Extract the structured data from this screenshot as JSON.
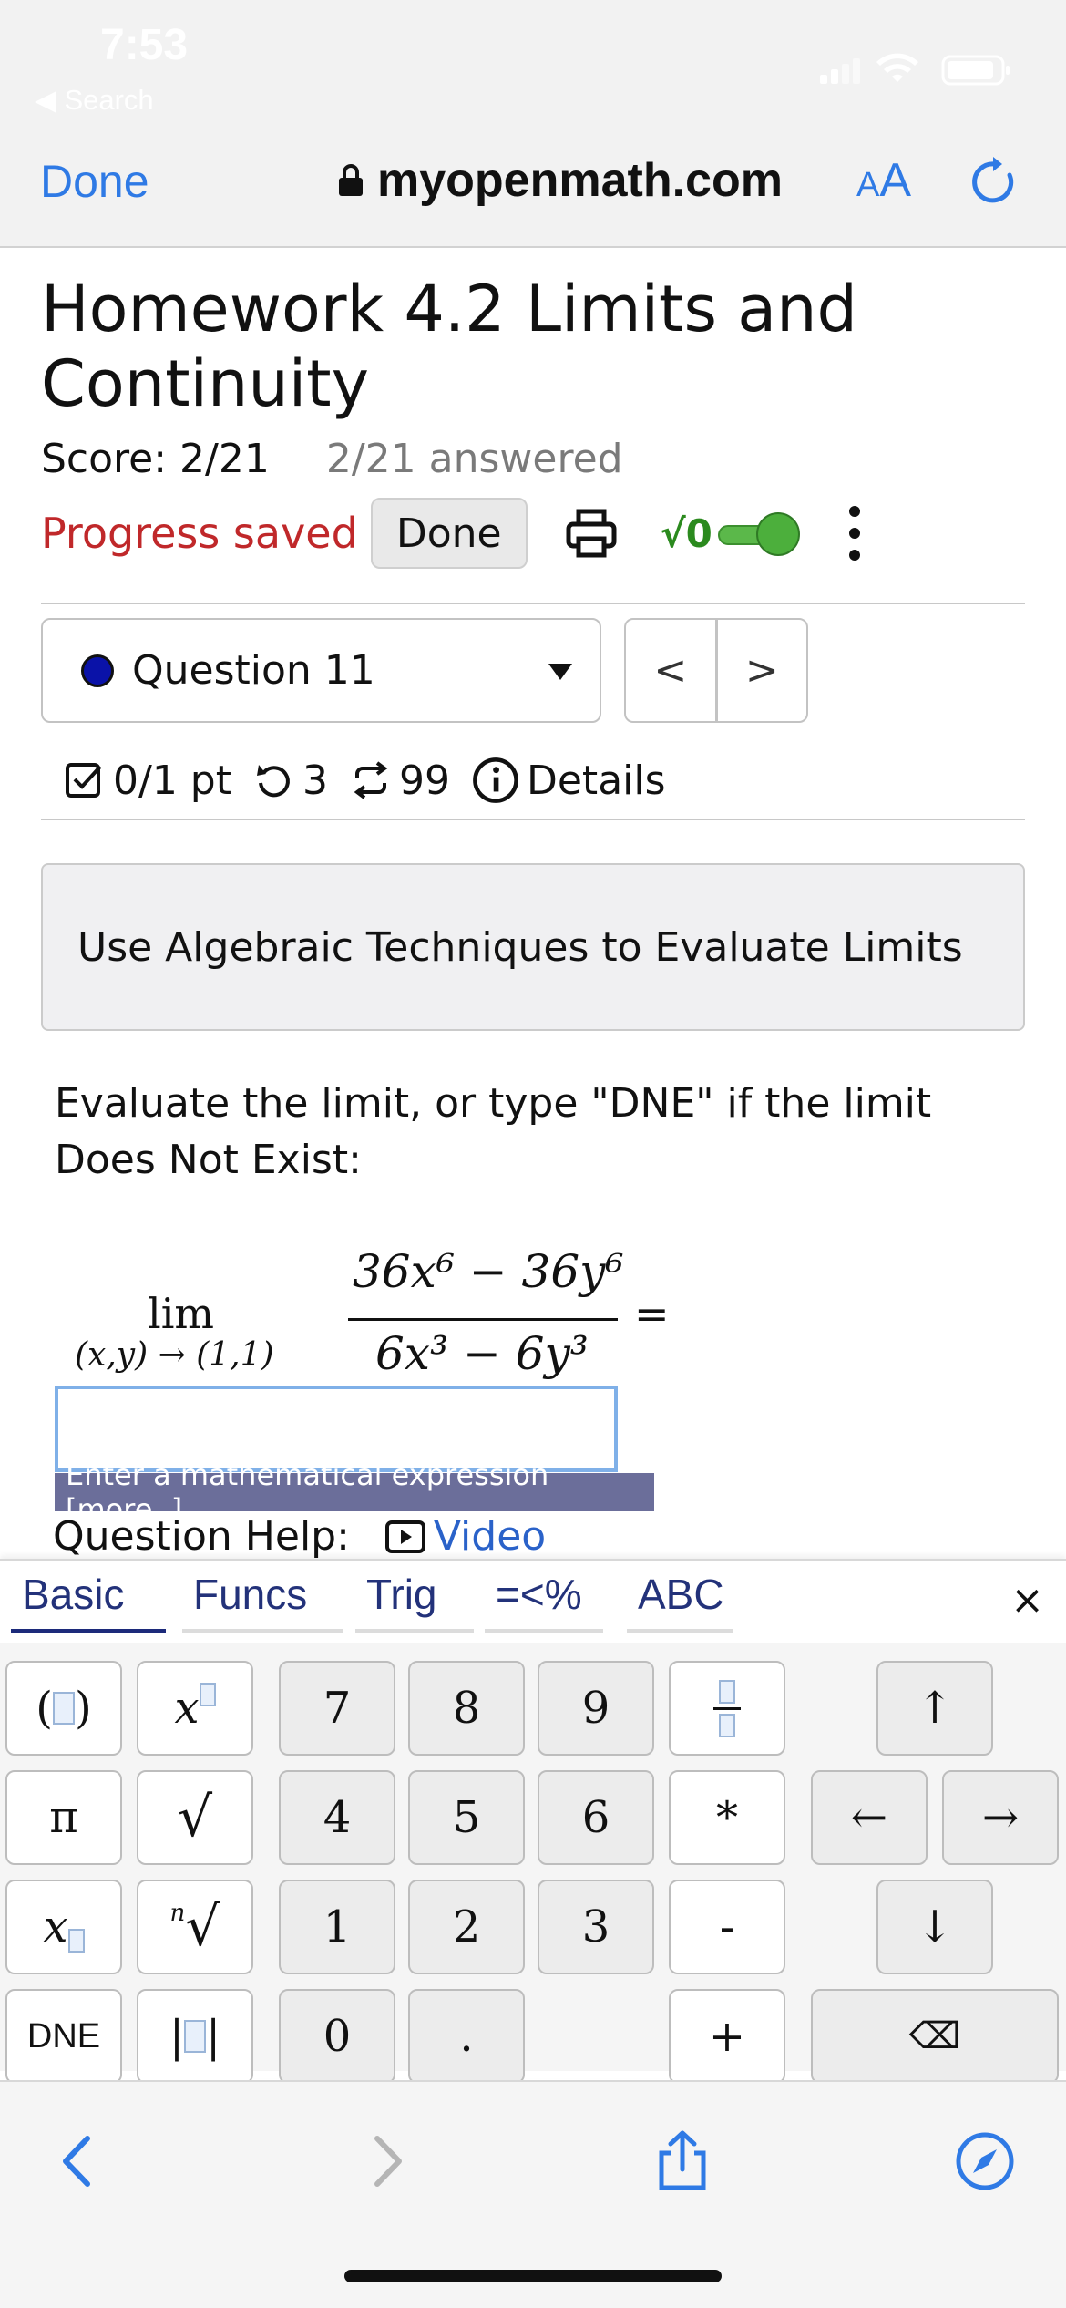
{
  "status": {
    "time": "7:53",
    "back": "◀ Search"
  },
  "browser": {
    "done": "Done",
    "domain": "myopenmath.com",
    "aa_small": "A",
    "aa_large": "A"
  },
  "page": {
    "title": "Homework 4.2 Limits and Continuity",
    "score": "Score: 2/21",
    "answered": "2/21 answered",
    "progress": "Progress saved",
    "done_button": "Done",
    "sqrt_label": "√0"
  },
  "question": {
    "selector": "Question 11",
    "prev": "<",
    "next": ">",
    "points": "0/1 pt",
    "retries": "3",
    "attempts": "99",
    "details": "Details",
    "banner": "Use Algebraic Techniques to Evaluate Limits",
    "prompt": "Evaluate the limit, or type \"DNE\" if the limit Does Not Exist:",
    "lim": "lim",
    "lim_sub": "(x,y) → (1,1)",
    "numerator": "36x⁶ − 36y⁶",
    "denominator": "6x³ − 6y³",
    "equals": "=",
    "answer_value": "",
    "hint": "Enter a mathematical expression [more..]",
    "help_label": "Question Help:",
    "video": "Video"
  },
  "keyboard": {
    "tabs": [
      "Basic",
      "Funcs",
      "Trig",
      "=<%",
      "ABC"
    ],
    "active_tab": "Basic",
    "close": "×",
    "keys": {
      "pi": "π",
      "sqrt": "√",
      "dne": "DNE",
      "n7": "7",
      "n8": "8",
      "n9": "9",
      "n4": "4",
      "n5": "5",
      "n6": "6",
      "n1": "1",
      "n2": "2",
      "n3": "3",
      "n0": "0",
      "dot": ".",
      "times": "*",
      "minus": "-",
      "plus": "+",
      "up": "↑",
      "left": "←",
      "right": "→",
      "down": "↓",
      "backspace": "⌫"
    }
  },
  "icons": [
    "lock-icon",
    "reload-icon",
    "print-icon",
    "checkbox-icon",
    "retry-icon",
    "attempts-icon",
    "info-icon",
    "video-icon",
    "back-arrow-icon",
    "forward-arrow-icon",
    "share-icon",
    "compass-icon"
  ],
  "colors": {
    "link_blue": "#2f7ae5",
    "progress_red": "#c0282a",
    "toggle_green": "#4caf3c",
    "hint_bg": "#6b6e9a",
    "tab_active": "#1c2a7a"
  }
}
